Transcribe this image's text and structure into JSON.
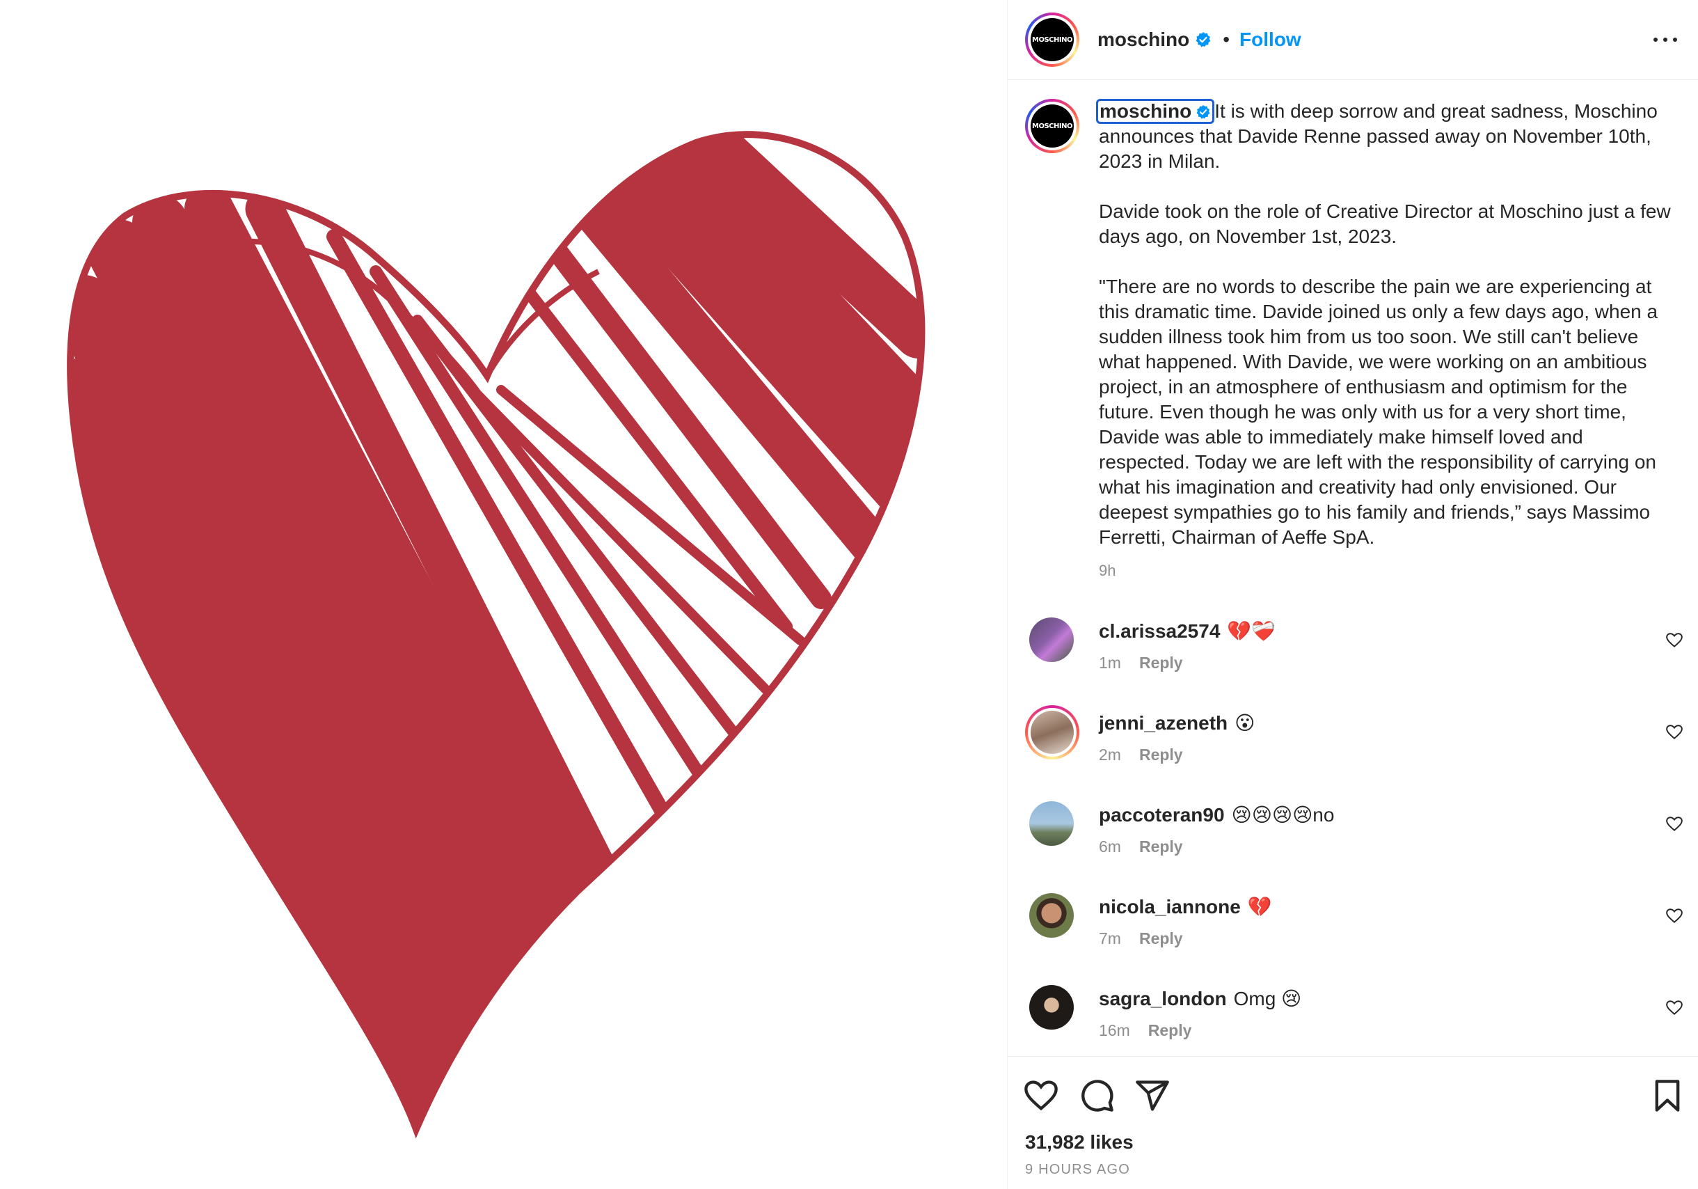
{
  "post": {
    "account": "moschino",
    "avatar_text": "MOSCHINO",
    "follow_label": "Follow",
    "separator": "•",
    "media_description_icon": "red-scribbled-heart",
    "accent_color": "#0095f6",
    "heart_color": "#b5343f"
  },
  "caption": {
    "username": "moschino",
    "text_first": "It is with deep sorrow and great sadness, Moschino announces that Davide Renne passed away on November 10th, 2023 in Milan.",
    "text_second": "Davide took on the role of Creative Director at Moschino just a few days ago, on November 1st, 2023.",
    "text_third": "\"There are no words to describe the pain we are experiencing at this dramatic time. Davide joined us only a few days ago, when a sudden illness took him from us too soon. We still can't believe what happened. With Davide, we were working on an ambitious project, in an atmosphere of enthusiasm and optimism for the future. Even though he was only with us for a very short time, Davide was able to immediately make himself loved and respected. Today we are left with the responsibility of carrying on what his imagination and creativity had only envisioned. Our deepest sympathies go to his family and friends,” says Massimo Ferretti, Chairman of Aeffe SpA.",
    "time": "9h"
  },
  "comments": [
    {
      "user": "cl.arissa2574",
      "text": "💔❤️‍🩹",
      "time": "1m",
      "reply": "Reply"
    },
    {
      "user": "jenni_azeneth",
      "text": "😮",
      "time": "2m",
      "reply": "Reply"
    },
    {
      "user": "paccoteran90",
      "text": "😢😢😢😢no",
      "time": "6m",
      "reply": "Reply"
    },
    {
      "user": "nicola_iannone",
      "text": "💔",
      "time": "7m",
      "reply": "Reply"
    },
    {
      "user": "sagra_london",
      "text": "Omg 😢",
      "time": "16m",
      "reply": "Reply"
    }
  ],
  "footer": {
    "likes": "31,982 likes",
    "ago": "9 HOURS AGO"
  }
}
